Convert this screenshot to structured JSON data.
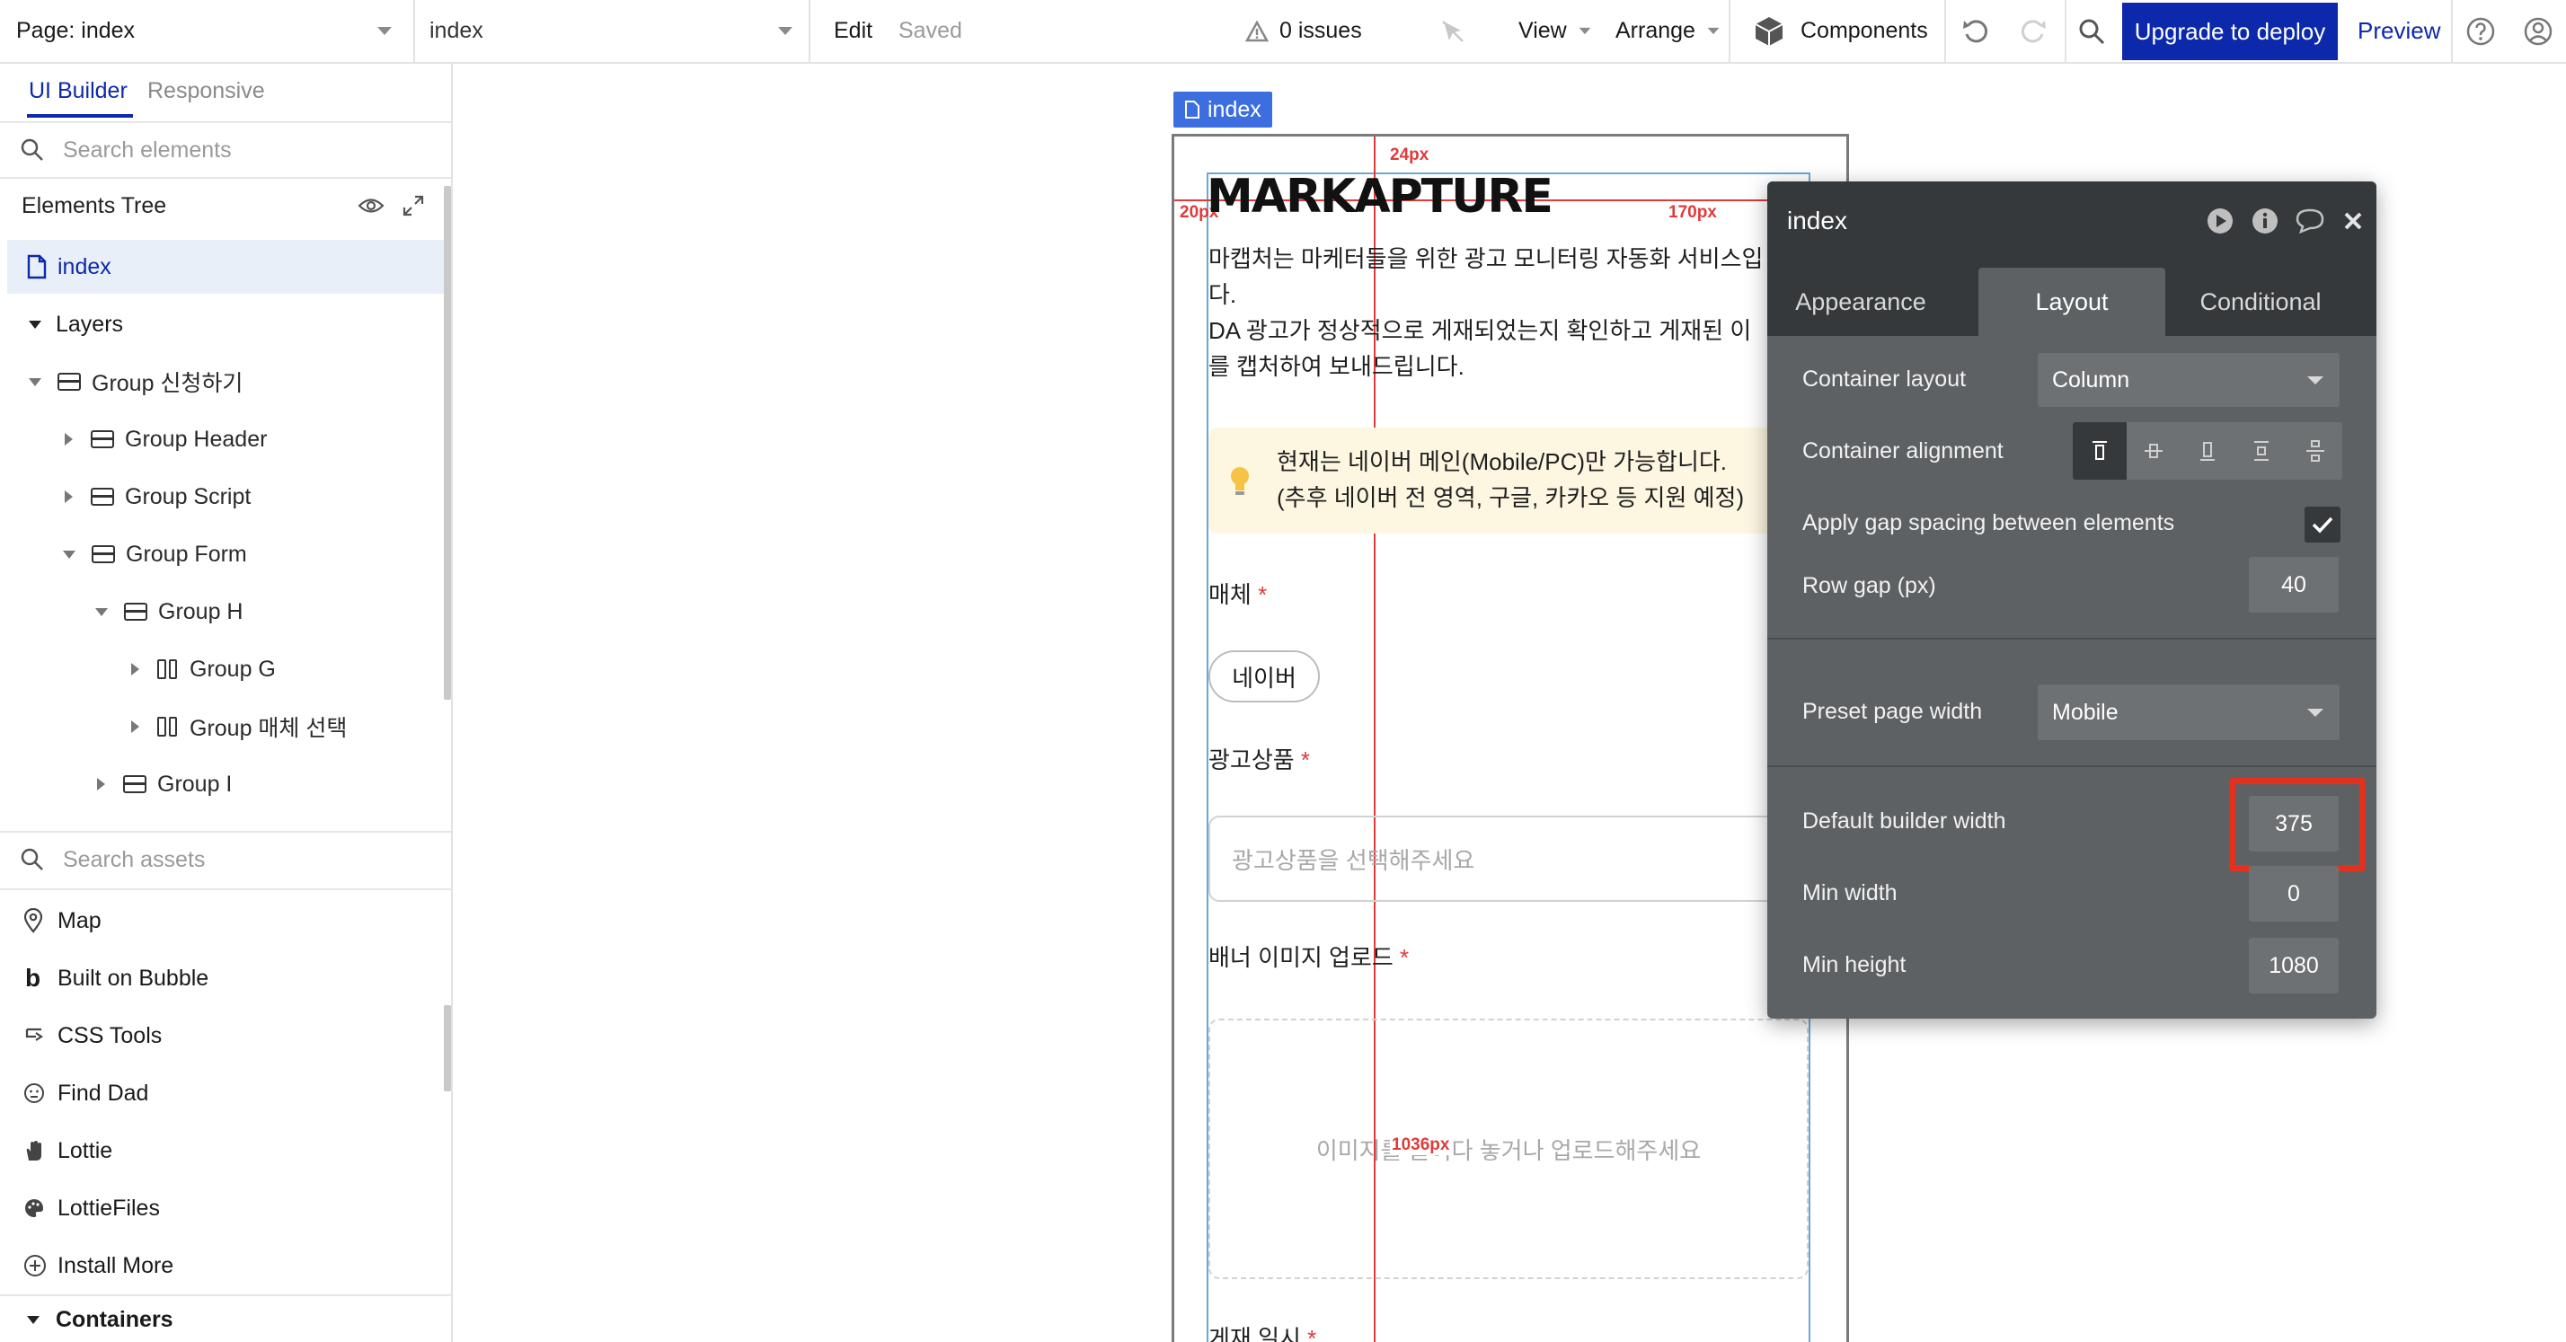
{
  "topbar": {
    "page_selector": "Page: index",
    "view_selector": "index",
    "edit": "Edit",
    "saved": "Saved",
    "issues": "0 issues",
    "view": "View",
    "arrange": "Arrange",
    "components": "Components",
    "upgrade": "Upgrade to deploy",
    "preview": "Preview"
  },
  "left": {
    "tabs": [
      "UI Builder",
      "Responsive"
    ],
    "search_elements_placeholder": "Search elements",
    "tree_title": "Elements Tree",
    "tree": [
      {
        "label": "index"
      },
      {
        "label": "Layers"
      },
      {
        "label": "Group 신청하기"
      },
      {
        "label": "Group Header"
      },
      {
        "label": "Group Script"
      },
      {
        "label": "Group Form"
      },
      {
        "label": "Group H"
      },
      {
        "label": "Group G"
      },
      {
        "label": "Group 매체 선택"
      },
      {
        "label": "Group I"
      }
    ],
    "search_assets_placeholder": "Search assets",
    "assets": [
      "Map",
      "Built on Bubble",
      "CSS Tools",
      "Find Dad",
      "Lottie",
      "LottieFiles",
      "Install More"
    ],
    "containers": "Containers"
  },
  "canvas": {
    "page_tag": "index",
    "logo": "MARKAPTURE",
    "desc_lines": [
      "마캡처는 마케터들을 위한 광고 모니터링 자동화 서비스입",
      "다.",
      "DA 광고가 정상적으로 게재되었는지 확인하고 게재된 이",
      "를 캡처하여 보내드립니다."
    ],
    "notice_lines": [
      "현재는 네이버 메인(Mobile/PC)만 가능합니다.",
      "(추후 네이버 전 영역, 구글, 카카오 등 지원 예정)"
    ],
    "media_label": "매체",
    "media_chip": "네이버",
    "product_label": "광고상품",
    "product_placeholder": "광고상품을 선택해주세요",
    "banner_label": "배너 이미지 업로드",
    "banner_placeholder": "이미지를 끌어다 놓거나 업로드해주세요",
    "date_label": "게재 일시",
    "required": "*",
    "measure_24": "24px",
    "measure_20": "20px",
    "measure_170": "170px",
    "measure_1036": "1036px"
  },
  "editor": {
    "title": "index",
    "tabs": [
      "Appearance",
      "Layout",
      "Conditional"
    ],
    "container_layout_label": "Container layout",
    "container_layout_value": "Column",
    "container_alignment_label": "Container alignment",
    "gap_label": "Apply gap spacing between elements",
    "gap_checked": true,
    "row_gap_label": "Row gap (px)",
    "row_gap_value": "40",
    "preset_label": "Preset page width",
    "preset_value": "Mobile",
    "default_width_label": "Default builder width",
    "default_width_value": "375",
    "min_width_label": "Min width",
    "min_width_value": "0",
    "min_height_label": "Min height",
    "min_height_value": "1080"
  },
  "colors": {
    "accent": "#0c29ab",
    "highlight": "#e3311d",
    "panel": "#5d6164",
    "required": "#e03a3a"
  }
}
